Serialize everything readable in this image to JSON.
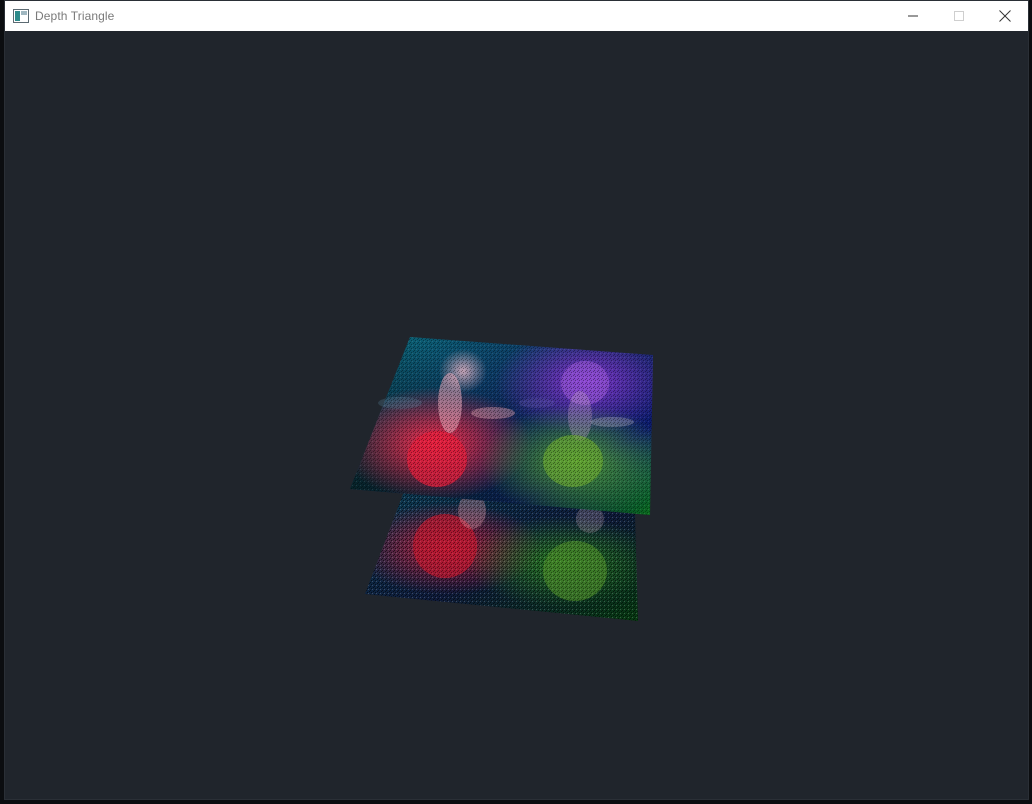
{
  "window": {
    "title": "Depth Triangle",
    "icon": "app-window-icon",
    "controls": [
      "minimize-icon",
      "maximize-icon",
      "close-icon"
    ],
    "background_color": "#20252c",
    "titlebar_color": "#ffffff"
  },
  "scene": {
    "description_icon": "rendered-3d-scene",
    "quads": [
      {
        "name": "front-quad",
        "colors": [
          "#ff2a2a",
          "#2a6cff",
          "#18ff18",
          "#003d4a"
        ]
      },
      {
        "name": "back-quad",
        "colors": [
          "#e01c1c",
          "#17318c",
          "#0ee80e",
          "#002533"
        ]
      }
    ]
  }
}
